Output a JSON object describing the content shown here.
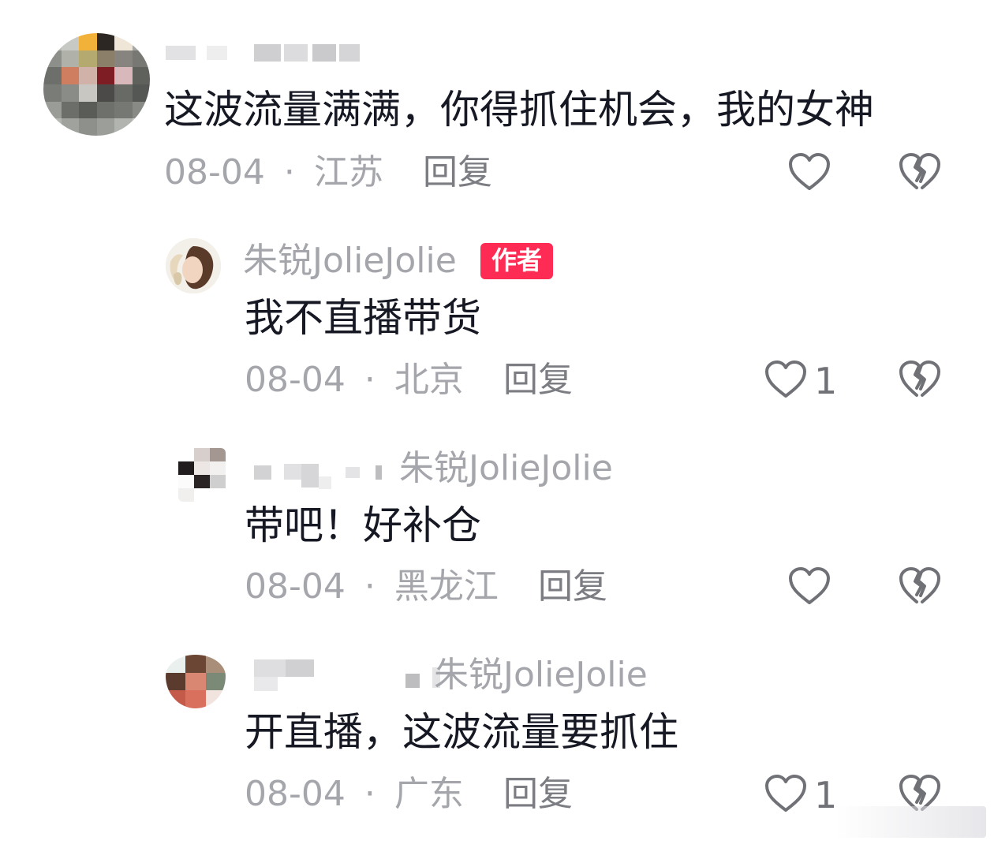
{
  "comments": [
    {
      "username": "",
      "text": "这波流量满满，你得抓住机会，我的女神",
      "date": "08-04",
      "location": "江苏",
      "reply_label": "回复",
      "like_count": ""
    },
    {
      "username": "朱锐JolieJolie",
      "author_badge": "作者",
      "text": "我不直播带货",
      "date": "08-04",
      "location": "北京",
      "reply_label": "回复",
      "like_count": "1"
    },
    {
      "username": "",
      "reply_to": "朱锐JolieJolie",
      "text": "带吧！好补仓",
      "date": "08-04",
      "location": "黑龙江",
      "reply_label": "回复",
      "like_count": ""
    },
    {
      "username": "",
      "reply_to": "朱锐JolieJolie",
      "text": "开直播，这波流量要抓住",
      "date": "08-04",
      "location": "广东",
      "reply_label": "回复",
      "like_count": "1"
    }
  ],
  "separator": "·",
  "icons": {
    "like": "heart-outline-icon",
    "dislike": "broken-heart-icon"
  },
  "colors": {
    "badge": "#fe2c55",
    "text": "#161823",
    "meta": "#a4a6ab"
  }
}
